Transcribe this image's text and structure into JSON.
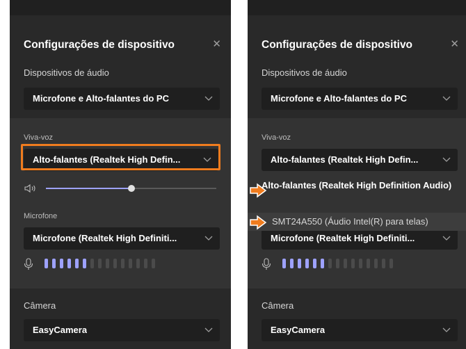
{
  "dialog": {
    "title": "Configurações de dispositivo",
    "close_icon": "close-icon"
  },
  "audio": {
    "label": "Dispositivos de áudio",
    "selected": "Microfone e Alto-falantes do PC"
  },
  "speaker": {
    "label": "Viva-voz",
    "selected": "Alto-falantes (Realtek High Defin...",
    "volume_fraction": 0.5
  },
  "microphone": {
    "label": "Microfone",
    "selected": "Microfone (Realtek High Definiti...",
    "level_bars_total": 15,
    "level_bars_active": 6
  },
  "camera": {
    "label": "Câmera",
    "selected": "EasyCamera"
  },
  "speaker_menu": {
    "items": [
      "Alto-falantes (Realtek High Definition Audio)",
      "SMT24A550 (Áudio Intel(R) para telas)"
    ]
  },
  "colors": {
    "highlight": "#f07c1e",
    "accent": "#9ea2ff",
    "panel_bg": "#292929"
  }
}
